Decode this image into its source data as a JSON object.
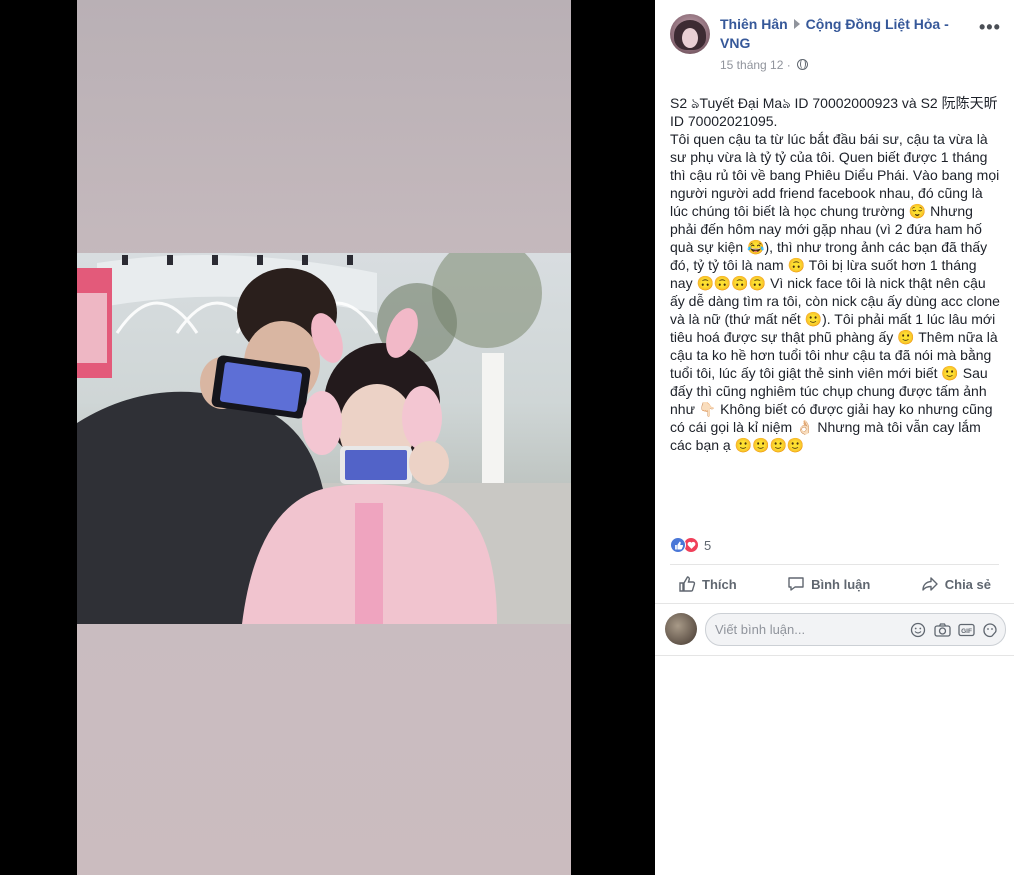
{
  "post": {
    "author": "Thiên Hân",
    "group": "Cộng Đồng Liệt Hỏa - VNG",
    "date": "15 tháng 12 ·",
    "more_label": "•••",
    "text": "S2 ঌTuyết Đại Maঌ ID 70002000923 và S2 阮陈天昕 ID 70002021095.\nTôi quen cậu ta từ lúc bắt đầu bái sư, cậu ta vừa là sư phụ vừa là tỷ tỷ của tôi. Quen biết được 1 tháng thì cậu rủ tôi về bang Phiêu Diểu Phái. Vào bang mọi người người add friend facebook nhau, đó cũng là lúc chúng tôi biết là học chung trường 😌 Nhưng phải đến hôm nay mới gặp nhau (vì 2 đứa ham hố quà sự kiện 😂), thì như trong ảnh các bạn đã thấy đó, tỷ tỷ tôi là nam 🙃 Tôi bị lừa suốt hơn 1 tháng nay 🙃🙃🙃🙃 Vì nick face tôi là nick thật nên cậu ấy dễ dàng tìm ra tôi, còn nick cậu ấy dùng acc clone và là nữ (thứ mất nết 🙂). Tôi phải mất 1 lúc lâu mới tiêu hoá được sự thật phũ phàng ấy 🙂 Thêm nữa là cậu ta ko hề hơn tuổi tôi như cậu ta đã nói mà bằng tuổi tôi, lúc ấy tôi giật thẻ sinh viên mới biết 🙂 Sau đấy thì cũng nghiêm túc chụp chung được tấm ảnh như 👇🏻 Không biết có được giải hay ko nhưng cũng có cái gọi là kỉ niệm 👌🏻 Nhưng mà tôi vẫn cay lắm các bạn ạ 🙂🙂🙂🙂"
  },
  "reactions": {
    "count": "5",
    "types": [
      "like",
      "love"
    ],
    "like_color": "#4a77d7",
    "love_color": "#f0405a"
  },
  "actions": {
    "like": "Thích",
    "comment": "Bình luận",
    "share": "Chia sẻ"
  },
  "comment": {
    "placeholder": "Viết bình luận..."
  },
  "icons": [
    "arrow-icon",
    "globe-icon",
    "more-icon",
    "like-icon",
    "comment-icon",
    "share-icon",
    "emoji-icon",
    "camera-icon",
    "gif-icon",
    "sticker-icon"
  ]
}
